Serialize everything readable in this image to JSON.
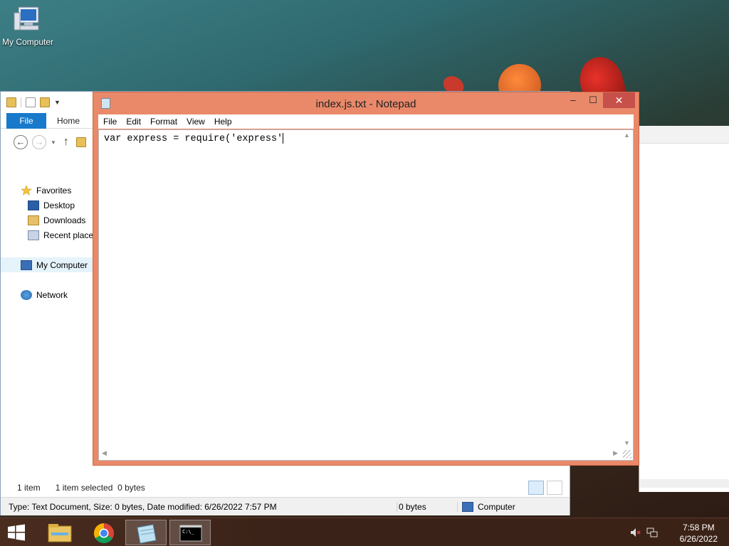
{
  "desktop": {
    "icons": [
      {
        "label": "My Computer",
        "icon": "computer-icon"
      }
    ]
  },
  "explorer": {
    "ribbon_tabs": [
      "File",
      "Home"
    ],
    "sidebar": [
      {
        "label": "Favorites",
        "icon": "star-icon"
      },
      {
        "label": "Desktop",
        "icon": "desktop-icon"
      },
      {
        "label": "Downloads",
        "icon": "downloads-icon"
      },
      {
        "label": "Recent places",
        "icon": "recent-places-icon"
      },
      {
        "label": "My Computer",
        "icon": "computer-icon"
      },
      {
        "label": "Network",
        "icon": "network-icon"
      }
    ],
    "status": {
      "count": "1 item",
      "selected": "1 item selected  0 bytes"
    },
    "details": {
      "info": "Type: Text Document, Size: 0 bytes, Date modified: 6/26/2022 7:57 PM",
      "size": "0 bytes",
      "location": "Computer"
    }
  },
  "notepad": {
    "title": "index.js.txt - Notepad",
    "menu": [
      "File",
      "Edit",
      "Format",
      "View",
      "Help"
    ],
    "content": "var express = require('express'",
    "controls": {
      "minimize": "–",
      "maximize": "☐",
      "close": "✕"
    }
  },
  "taskbar": {
    "apps": [
      "start-icon",
      "file-explorer-icon",
      "chrome-icon",
      "notepad-icon",
      "command-prompt-icon"
    ],
    "clock": {
      "time": "7:58 PM",
      "date": "6/26/2022"
    }
  },
  "colors": {
    "notepad_frame": "#e9896a",
    "close_button": "#c7504a",
    "file_tab": "#1979ca"
  }
}
